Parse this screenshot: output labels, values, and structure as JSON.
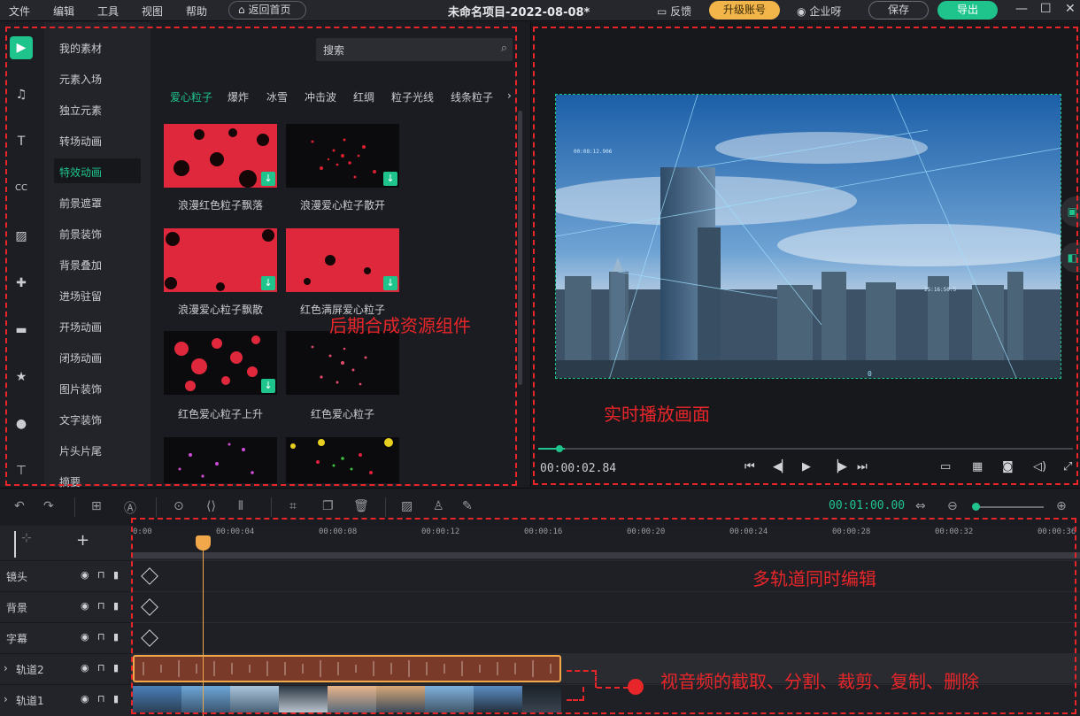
{
  "menu": {
    "file": "文件",
    "edit": "编辑",
    "tools": "工具",
    "view": "视图",
    "help": "帮助",
    "back_home": "返回首页"
  },
  "header": {
    "project_title": "未命名项目-2022-08-08*",
    "feedback": "反馈",
    "upgrade": "升级账号",
    "enterprise": "企业呀",
    "save": "保存",
    "export": "导出"
  },
  "categories": [
    "我的素材",
    "元素入场",
    "独立元素",
    "转场动画",
    "特效动画",
    "前景遮罩",
    "前景装饰",
    "背景叠加",
    "进场驻留",
    "开场动画",
    "闭场动画",
    "图片装饰",
    "文字装饰",
    "片头片尾",
    "摘要"
  ],
  "active_category": "特效动画",
  "search": {
    "placeholder": "搜索"
  },
  "sub_tabs": [
    "爱心粒子",
    "爆炸",
    "冰雪",
    "冲击波",
    "红绸",
    "粒子光线",
    "线条粒子"
  ],
  "active_sub_tab": "爱心粒子",
  "resources": [
    {
      "label": "浪漫红色粒子飘落",
      "downloadable": true
    },
    {
      "label": "浪漫爱心粒子散开",
      "downloadable": true
    },
    {
      "label": "浪漫爱心粒子飘散",
      "downloadable": true
    },
    {
      "label": "红色满屏爱心粒子",
      "downloadable": true
    },
    {
      "label": "红色爱心粒子上升",
      "downloadable": true
    },
    {
      "label": "红色爱心粒子",
      "downloadable": false
    },
    {
      "label": "",
      "downloadable": false
    },
    {
      "label": "",
      "downloadable": false
    }
  ],
  "preview": {
    "current_time": "00:00:02.84",
    "progress_fraction": 0.05,
    "hud_labels": [
      "00:08:12.906",
      "25:16:50.5",
      "0"
    ]
  },
  "toolbar": {
    "zoom_time": "00:01:00.00",
    "zoom_level_fraction": 0.0
  },
  "timeline": {
    "ruler": [
      "0:00",
      "00:00:04",
      "00:00:08",
      "00:00:12",
      "00:00:16",
      "00:00:20",
      "00:00:24",
      "00:00:28",
      "00:00:32",
      "00:00:36"
    ],
    "tracks": [
      "镜头",
      "背景",
      "字幕",
      "轨道2",
      "轨道1"
    ],
    "playhead_time_seconds": 2.84
  },
  "annotations": {
    "resources": "后期合成资源组件",
    "preview": "实时播放画面",
    "multitrack": "多轨道同时编辑",
    "editing": "视音频的截取、分割、裁剪、复制、删除"
  },
  "colors": {
    "accent": "#1fc48c",
    "upgrade": "#f2b54a",
    "playhead": "#f0a84a",
    "annotation": "#e8262a",
    "audio_clip": "#7a3a2a"
  }
}
